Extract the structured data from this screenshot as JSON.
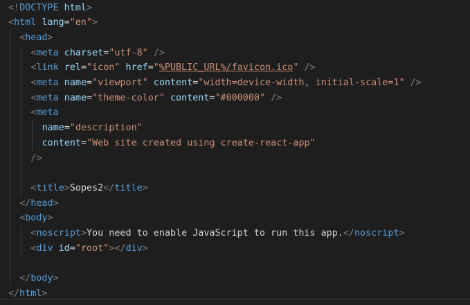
{
  "editor": {
    "language": "html",
    "colors": {
      "background": "#1e1e1e",
      "bracket": "#808080",
      "tag": "#569cd6",
      "attribute": "#9cdcfe",
      "string": "#ce9178",
      "text": "#d4d4d4",
      "indent_guide": "#404040"
    },
    "lines": [
      {
        "indent": 0,
        "tokens": [
          {
            "t": "bracket",
            "v": "<!"
          },
          {
            "t": "tag",
            "v": "DOCTYPE"
          },
          {
            "t": "text",
            "v": " "
          },
          {
            "t": "attr",
            "v": "html"
          },
          {
            "t": "bracket",
            "v": ">"
          }
        ]
      },
      {
        "indent": 0,
        "tokens": [
          {
            "t": "bracket",
            "v": "<"
          },
          {
            "t": "tag",
            "v": "html"
          },
          {
            "t": "text",
            "v": " "
          },
          {
            "t": "attr",
            "v": "lang"
          },
          {
            "t": "eq",
            "v": "="
          },
          {
            "t": "str",
            "v": "\"en\""
          },
          {
            "t": "bracket",
            "v": ">"
          }
        ]
      },
      {
        "indent": 1,
        "tokens": [
          {
            "t": "bracket",
            "v": "<"
          },
          {
            "t": "tag",
            "v": "head"
          },
          {
            "t": "bracket",
            "v": ">"
          }
        ]
      },
      {
        "indent": 2,
        "tokens": [
          {
            "t": "bracket",
            "v": "<"
          },
          {
            "t": "tag",
            "v": "meta"
          },
          {
            "t": "text",
            "v": " "
          },
          {
            "t": "attr",
            "v": "charset"
          },
          {
            "t": "eq",
            "v": "="
          },
          {
            "t": "str",
            "v": "\"utf-8\""
          },
          {
            "t": "text",
            "v": " "
          },
          {
            "t": "bracket",
            "v": "/>"
          }
        ]
      },
      {
        "indent": 2,
        "tokens": [
          {
            "t": "bracket",
            "v": "<"
          },
          {
            "t": "tag",
            "v": "link"
          },
          {
            "t": "text",
            "v": " "
          },
          {
            "t": "attr",
            "v": "rel"
          },
          {
            "t": "eq",
            "v": "="
          },
          {
            "t": "str",
            "v": "\"icon\""
          },
          {
            "t": "text",
            "v": " "
          },
          {
            "t": "attr",
            "v": "href"
          },
          {
            "t": "eq",
            "v": "="
          },
          {
            "t": "str",
            "v": "\""
          },
          {
            "t": "url",
            "v": "%PUBLIC_URL%/favicon.ico"
          },
          {
            "t": "str",
            "v": "\""
          },
          {
            "t": "text",
            "v": " "
          },
          {
            "t": "bracket",
            "v": "/>"
          }
        ]
      },
      {
        "indent": 2,
        "tokens": [
          {
            "t": "bracket",
            "v": "<"
          },
          {
            "t": "tag",
            "v": "meta"
          },
          {
            "t": "text",
            "v": " "
          },
          {
            "t": "attr",
            "v": "name"
          },
          {
            "t": "eq",
            "v": "="
          },
          {
            "t": "str",
            "v": "\"viewport\""
          },
          {
            "t": "text",
            "v": " "
          },
          {
            "t": "attr",
            "v": "content"
          },
          {
            "t": "eq",
            "v": "="
          },
          {
            "t": "str",
            "v": "\"width=device-width, initial-scale=1\""
          },
          {
            "t": "text",
            "v": " "
          },
          {
            "t": "bracket",
            "v": "/>"
          }
        ]
      },
      {
        "indent": 2,
        "tokens": [
          {
            "t": "bracket",
            "v": "<"
          },
          {
            "t": "tag",
            "v": "meta"
          },
          {
            "t": "text",
            "v": " "
          },
          {
            "t": "attr",
            "v": "name"
          },
          {
            "t": "eq",
            "v": "="
          },
          {
            "t": "str",
            "v": "\"theme-color\""
          },
          {
            "t": "text",
            "v": " "
          },
          {
            "t": "attr",
            "v": "content"
          },
          {
            "t": "eq",
            "v": "="
          },
          {
            "t": "str",
            "v": "\"#000000\""
          },
          {
            "t": "text",
            "v": " "
          },
          {
            "t": "bracket",
            "v": "/>"
          }
        ]
      },
      {
        "indent": 2,
        "tokens": [
          {
            "t": "bracket",
            "v": "<"
          },
          {
            "t": "tag",
            "v": "meta"
          }
        ]
      },
      {
        "indent": 3,
        "tokens": [
          {
            "t": "attr",
            "v": "name"
          },
          {
            "t": "eq",
            "v": "="
          },
          {
            "t": "str",
            "v": "\"description\""
          }
        ]
      },
      {
        "indent": 3,
        "tokens": [
          {
            "t": "attr",
            "v": "content"
          },
          {
            "t": "eq",
            "v": "="
          },
          {
            "t": "str",
            "v": "\"Web site created using create-react-app\""
          }
        ]
      },
      {
        "indent": 2,
        "tokens": [
          {
            "t": "bracket",
            "v": "/>"
          }
        ]
      },
      {
        "indent": 0,
        "tokens": []
      },
      {
        "indent": 2,
        "tokens": [
          {
            "t": "bracket",
            "v": "<"
          },
          {
            "t": "tag",
            "v": "title"
          },
          {
            "t": "bracket",
            "v": ">"
          },
          {
            "t": "text",
            "v": "Sopes2"
          },
          {
            "t": "bracket",
            "v": "</"
          },
          {
            "t": "tag",
            "v": "title"
          },
          {
            "t": "bracket",
            "v": ">"
          }
        ]
      },
      {
        "indent": 1,
        "tokens": [
          {
            "t": "bracket",
            "v": "</"
          },
          {
            "t": "tag",
            "v": "head"
          },
          {
            "t": "bracket",
            "v": ">"
          }
        ]
      },
      {
        "indent": 1,
        "tokens": [
          {
            "t": "bracket",
            "v": "<"
          },
          {
            "t": "tag",
            "v": "body"
          },
          {
            "t": "bracket",
            "v": ">"
          }
        ]
      },
      {
        "indent": 2,
        "tokens": [
          {
            "t": "bracket",
            "v": "<"
          },
          {
            "t": "tag",
            "v": "noscript"
          },
          {
            "t": "bracket",
            "v": ">"
          },
          {
            "t": "text",
            "v": "You need to enable JavaScript to run this app."
          },
          {
            "t": "bracket",
            "v": "</"
          },
          {
            "t": "tag",
            "v": "noscript"
          },
          {
            "t": "bracket",
            "v": ">"
          }
        ]
      },
      {
        "indent": 2,
        "tokens": [
          {
            "t": "bracket",
            "v": "<"
          },
          {
            "t": "tag",
            "v": "div"
          },
          {
            "t": "text",
            "v": " "
          },
          {
            "t": "attr",
            "v": "id"
          },
          {
            "t": "eq",
            "v": "="
          },
          {
            "t": "str",
            "v": "\"root\""
          },
          {
            "t": "bracket",
            "v": "></"
          },
          {
            "t": "tag",
            "v": "div"
          },
          {
            "t": "bracket",
            "v": ">"
          }
        ]
      },
      {
        "indent": 0,
        "tokens": []
      },
      {
        "indent": 1,
        "tokens": [
          {
            "t": "bracket",
            "v": "</"
          },
          {
            "t": "tag",
            "v": "body"
          },
          {
            "t": "bracket",
            "v": ">"
          }
        ]
      },
      {
        "indent": 0,
        "tokens": [
          {
            "t": "bracket",
            "v": "</"
          },
          {
            "t": "tag",
            "v": "html"
          },
          {
            "t": "bracket",
            "v": ">"
          }
        ]
      }
    ]
  }
}
